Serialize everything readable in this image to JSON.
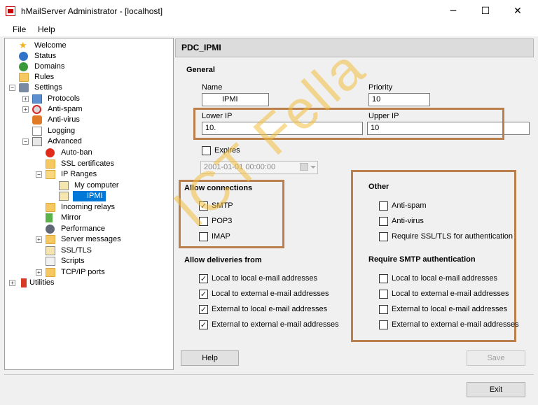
{
  "window": {
    "title": "hMailServer Administrator - [localhost]",
    "minimize_glyph": "─",
    "maximize_glyph": "☐",
    "close_glyph": "✕"
  },
  "menu": {
    "file": "File",
    "help": "Help"
  },
  "tree": {
    "welcome": "Welcome",
    "status": "Status",
    "domains": "Domains",
    "rules": "Rules",
    "settings": "Settings",
    "protocols": "Protocols",
    "anti_spam": "Anti-spam",
    "anti_virus": "Anti-virus",
    "logging": "Logging",
    "advanced": "Advanced",
    "auto_ban": "Auto-ban",
    "ssl_certificates": "SSL certificates",
    "ip_ranges": "IP Ranges",
    "my_computer": "My computer",
    "ipmi": "IPMI",
    "incoming_relays": "Incoming relays",
    "mirror": "Mirror",
    "performance": "Performance",
    "server_messages": "Server messages",
    "ssl_tls": "SSL/TLS",
    "scripts": "Scripts",
    "tcpip_ports": "TCP/IP ports",
    "utilities": "Utilities"
  },
  "panel": {
    "title": "PDC_IPMI",
    "general": "General",
    "name_label": "Name",
    "name_value": "IPMI",
    "priority_label": "Priority",
    "priority_value": "10",
    "lower_ip_label": "Lower IP",
    "lower_ip_value": "10.",
    "upper_ip_label": "Upper IP",
    "upper_ip_value": "10",
    "expires_label": "Expires",
    "expires_value": "2001-01-01 00:00:00",
    "allow_connections": "Allow connections",
    "smtp": "SMTP",
    "pop3": "POP3",
    "imap": "IMAP",
    "allow_deliveries": "Allow deliveries from",
    "local_to_local": "Local to local e-mail addresses",
    "local_to_external": "Local to external e-mail addresses",
    "external_to_local": "External to local e-mail addresses",
    "external_to_external": "External to external e-mail addresses",
    "other": "Other",
    "anti_spam": "Anti-spam",
    "anti_virus": "Anti-virus",
    "require_ssl": "Require SSL/TLS for authentication",
    "require_smtp_auth": "Require SMTP authentication",
    "auth_local_to_local": "Local to local e-mail addresses",
    "auth_local_to_external": "Local to external e-mail addresses",
    "auth_external_to_local": "External to local e-mail addresses",
    "auth_external_to_external": "External to external e-mail addresses",
    "help_button": "Help",
    "save_button": "Save",
    "check_glyph": "✓"
  },
  "exit_button": "Exit",
  "watermark": "ICT Fella",
  "colors": {
    "highlight_border": "#b97f4d",
    "watermark": "#f3be3c",
    "selected_node": "#0078d7"
  }
}
